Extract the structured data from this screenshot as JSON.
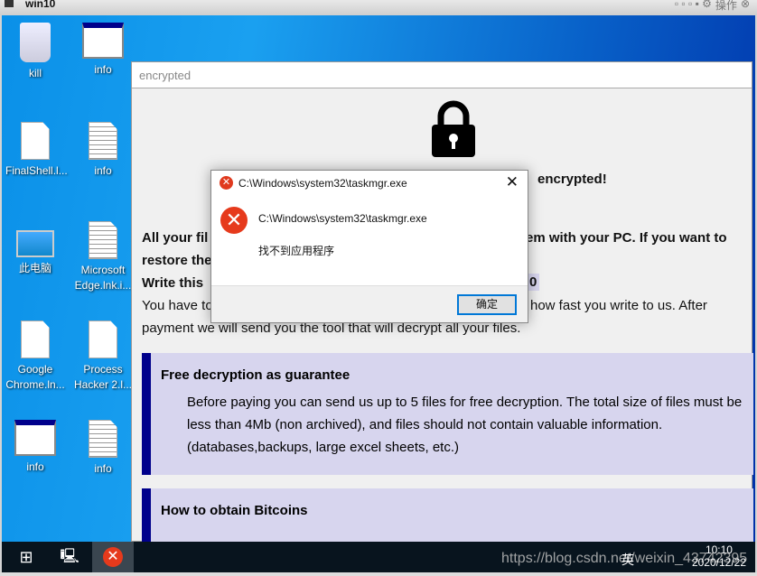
{
  "vm": {
    "title": "win10",
    "menu": "操作"
  },
  "desktop": {
    "icons": [
      {
        "label": "kill",
        "icon": "recycle-bin-icon"
      },
      {
        "label": "info",
        "icon": "window-icon"
      },
      {
        "label": "FinalShell.l...",
        "icon": "file-icon"
      },
      {
        "label": "info",
        "icon": "text-file-icon"
      },
      {
        "label": "此电脑",
        "icon": "computer-icon"
      },
      {
        "label": "Microsoft Edge.lnk.i...",
        "icon": "text-file-icon"
      },
      {
        "label": "Google Chrome.ln...",
        "icon": "file-icon"
      },
      {
        "label": "Process Hacker 2.l...",
        "icon": "file-icon"
      },
      {
        "label": "info",
        "icon": "window-icon"
      },
      {
        "label": "info",
        "icon": "text-file-icon"
      }
    ]
  },
  "ransom": {
    "window_title": "encrypted",
    "heading": "encrypted!",
    "l1a": "All your fil",
    "l1b": "em with your PC. If you want to",
    "l2": "restore the",
    "l3a": "Write this",
    "l3b": "0",
    "l4a": "You have to",
    "l4b": "how fast you write to us. After",
    "l5": "payment we will send you the tool that will decrypt all your files.",
    "box1_title": "Free decryption as guarantee",
    "box1_text": "Before paying you can send us up to 5 files for free decryption. The total size of files must be less than 4Mb (non archived), and files should not contain valuable information. (databases,backups, large excel sheets, etc.)",
    "box2_title": "How to obtain Bitcoins"
  },
  "dialog": {
    "title": "C:\\Windows\\system32\\taskmgr.exe",
    "path": "C:\\Windows\\system32\\taskmgr.exe",
    "message": "找不到应用程序",
    "ok": "确定"
  },
  "taskbar": {
    "time": "10:10",
    "date": "2020/12/22",
    "ime": "英",
    "watermark": "https://blog.csdn.net/weixin_43742395"
  },
  "colors": {
    "accent": "#00008b",
    "box": "#d7d5ee",
    "error": "#e63a1c"
  }
}
